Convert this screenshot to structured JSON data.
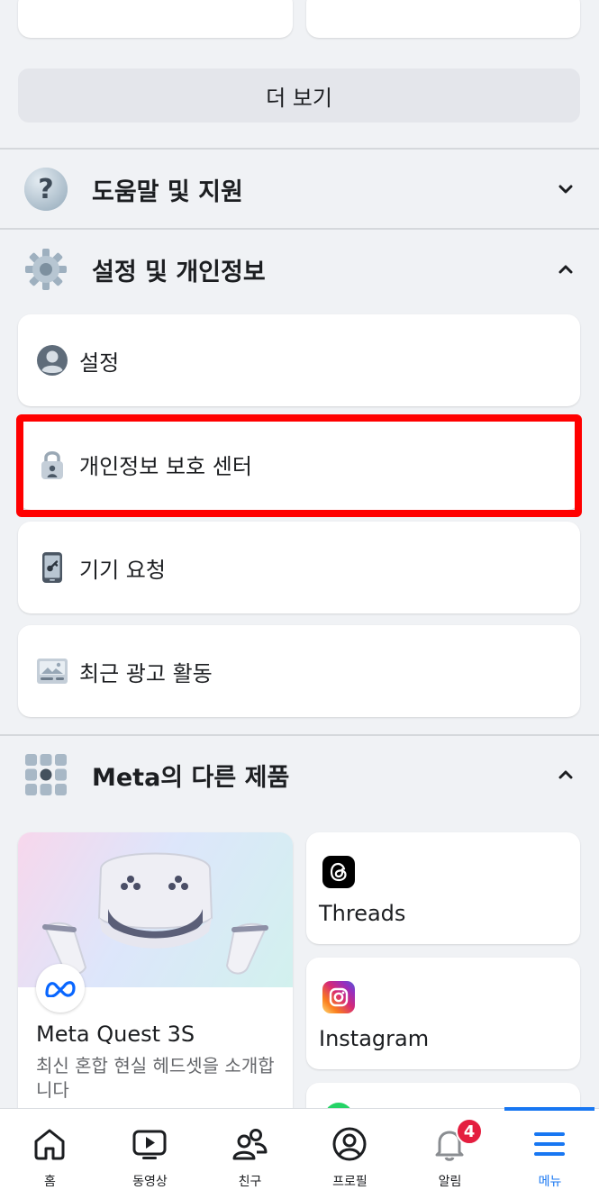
{
  "more_button": {
    "label": "더 보기"
  },
  "sections": {
    "help": {
      "label": "도움말 및 지원",
      "icon": "question-icon",
      "expanded": false
    },
    "settings": {
      "label": "설정 및 개인정보",
      "icon": "gear-icon",
      "expanded": true
    },
    "meta": {
      "label": "Meta의 다른 제품",
      "icon": "apps-grid-icon",
      "expanded": true
    }
  },
  "settings_items": [
    {
      "label": "설정",
      "icon": "profile-circle-icon"
    },
    {
      "label": "개인정보 보호 센터",
      "icon": "lock-icon",
      "highlighted": true
    },
    {
      "label": "기기 요청",
      "icon": "phone-key-icon"
    },
    {
      "label": "최근 광고 활동",
      "icon": "ad-image-icon"
    }
  ],
  "products": {
    "quest": {
      "title": "Meta Quest 3S",
      "description": "최신 혼합 현실 헤드셋을 소개합니다",
      "icon": "meta-logo-icon"
    },
    "threads": {
      "name": "Threads",
      "icon": "threads-icon"
    },
    "instagram": {
      "name": "Instagram",
      "icon": "instagram-icon"
    }
  },
  "tabbar": {
    "tabs": [
      {
        "label": "홈",
        "icon": "home-icon"
      },
      {
        "label": "동영상",
        "icon": "video-icon"
      },
      {
        "label": "친구",
        "icon": "friends-icon"
      },
      {
        "label": "프로필",
        "icon": "profile-icon"
      },
      {
        "label": "알림",
        "icon": "bell-icon",
        "badge": "4"
      },
      {
        "label": "메뉴",
        "icon": "menu-icon",
        "active": true
      }
    ]
  },
  "colors": {
    "accent": "#1877f2",
    "highlight": "#ff0000",
    "badge": "#e41e3f",
    "background": "#f0f2f5"
  }
}
